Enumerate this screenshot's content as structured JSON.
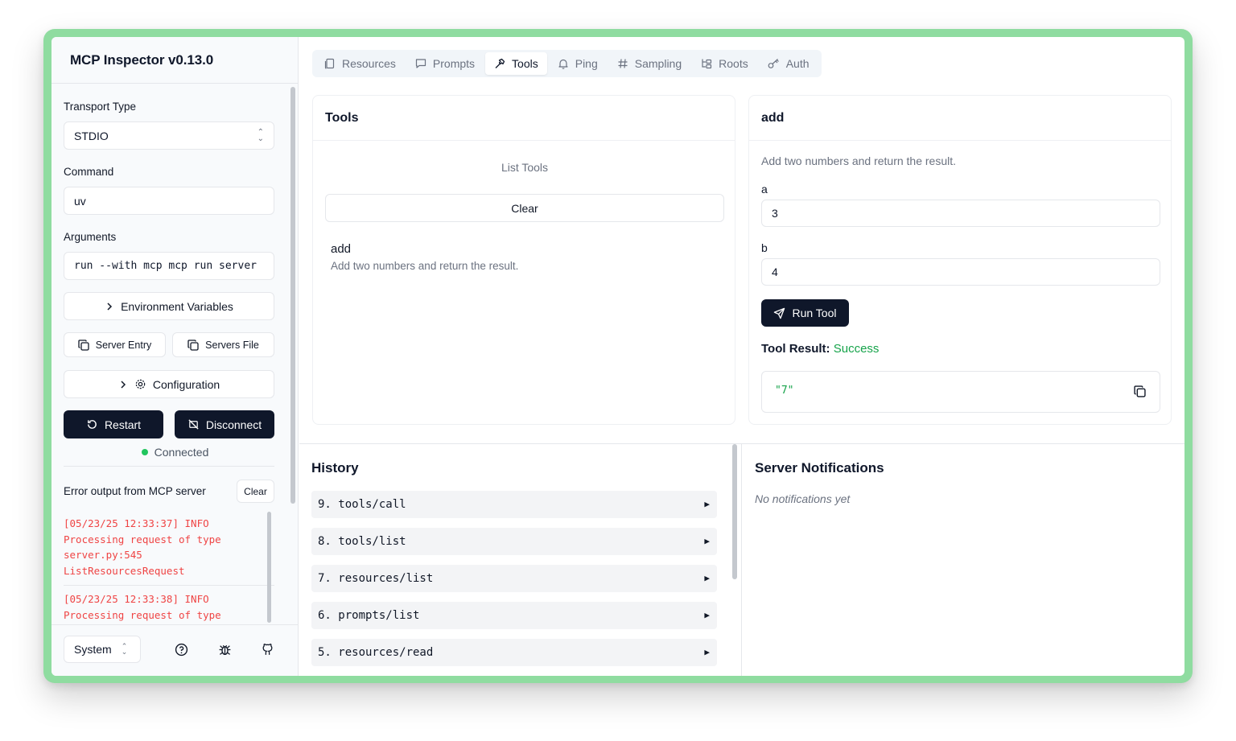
{
  "app": {
    "title": "MCP Inspector v0.13.0"
  },
  "sidebar": {
    "transport_label": "Transport Type",
    "transport_value": "STDIO",
    "command_label": "Command",
    "command_value": "uv",
    "arguments_label": "Arguments",
    "arguments_value": "run --with mcp mcp run server",
    "env_vars_label": "Environment Variables",
    "server_entry_label": "Server Entry",
    "servers_file_label": "Servers File",
    "configuration_label": "Configuration",
    "restart_label": "Restart",
    "disconnect_label": "Disconnect",
    "status_text": "Connected",
    "status_color": "#22c55e",
    "error_output_label": "Error output from MCP server",
    "error_clear_label": "Clear",
    "error_entries": [
      "[05/23/25 12:33:37] INFO\nProcessing request of type\nserver.py:545\nListResourcesRequest",
      "[05/23/25 12:33:38] INFO\nProcessing request of type"
    ],
    "theme_value": "System"
  },
  "tabs": [
    {
      "label": "Resources",
      "icon": "file-icon"
    },
    {
      "label": "Prompts",
      "icon": "message-icon"
    },
    {
      "label": "Tools",
      "icon": "hammer-icon",
      "active": true
    },
    {
      "label": "Ping",
      "icon": "bell-icon"
    },
    {
      "label": "Sampling",
      "icon": "hash-icon"
    },
    {
      "label": "Roots",
      "icon": "folder-tree-icon"
    },
    {
      "label": "Auth",
      "icon": "key-icon"
    }
  ],
  "tools_panel": {
    "title": "Tools",
    "list_tools_label": "List Tools",
    "clear_label": "Clear",
    "tool_name": "add",
    "tool_description": "Add two numbers and return the result."
  },
  "tool_detail": {
    "title": "add",
    "description": "Add two numbers and return the result.",
    "param_a_label": "a",
    "param_a_value": "3",
    "param_b_label": "b",
    "param_b_value": "4",
    "run_label": "Run Tool",
    "result_label": "Tool Result:",
    "result_status": "Success",
    "result_status_color": "#16a34a",
    "result_value": "\"7\""
  },
  "history": {
    "title": "History",
    "items": [
      {
        "label": "9. tools/call"
      },
      {
        "label": "8. tools/list"
      },
      {
        "label": "7. resources/list"
      },
      {
        "label": "6. prompts/list"
      },
      {
        "label": "5. resources/read"
      }
    ]
  },
  "notifications": {
    "title": "Server Notifications",
    "empty_text": "No notifications yet"
  }
}
